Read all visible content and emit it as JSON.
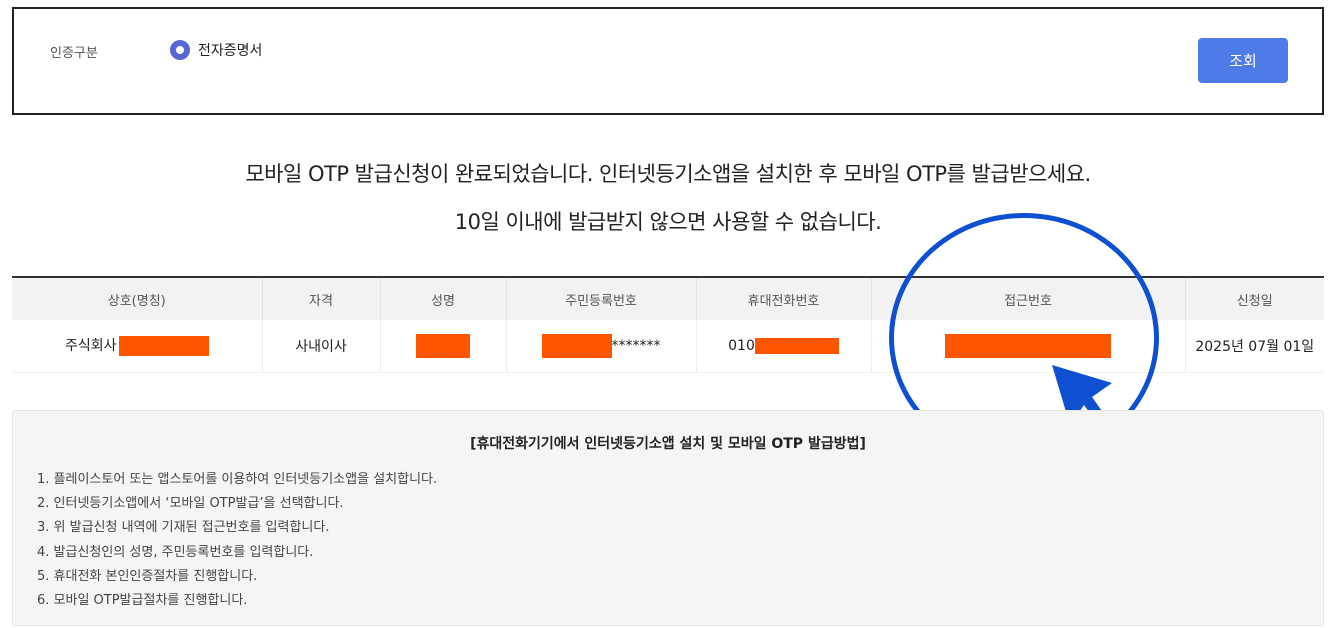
{
  "search": {
    "label": "인증구분",
    "radio_label": "전자증명서",
    "button_label": "조회"
  },
  "notice": {
    "line1": "모바일 OTP 발급신청이 완료되었습니다. 인터넷등기소앱을 설치한 후 모바일 OTP를 발급받으세요.",
    "line2": "10일 이내에 발급받지 않으면 사용할 수 없습니다."
  },
  "table": {
    "headers": [
      "상호(명칭)",
      "자격",
      "성명",
      "주민등록번호",
      "휴대전화번호",
      "접근번호",
      "신청일"
    ],
    "row": {
      "company_prefix": "주식회사",
      "role": "사내이사",
      "rrn_suffix": "*******",
      "phone_prefix": "010",
      "date": "2025년 07월 01일"
    },
    "redaction_color": "#ff5500"
  },
  "annotation": {
    "color": "#0f4fd1"
  },
  "guide": {
    "title": "[휴대전화기기에서 인터넷등기소앱 설치 및 모바일 OTP 발급방법]",
    "steps": [
      "1. 플레이스토어 또는 앱스토어를 이용하여 인터넷등기소앱을 설치합니다.",
      "2. 인터넷등기소앱에서 ‘모바일 OTP발급’을 선택합니다.",
      "3. 위 발급신청 내역에 기재된 접근번호를 입력합니다.",
      "4. 발급신청인의 성명, 주민등록번호를 입력합니다.",
      "5. 휴대전화 본인인증절차를 진행합니다.",
      "6. 모바일 OTP발급절차를 진행합니다."
    ]
  }
}
